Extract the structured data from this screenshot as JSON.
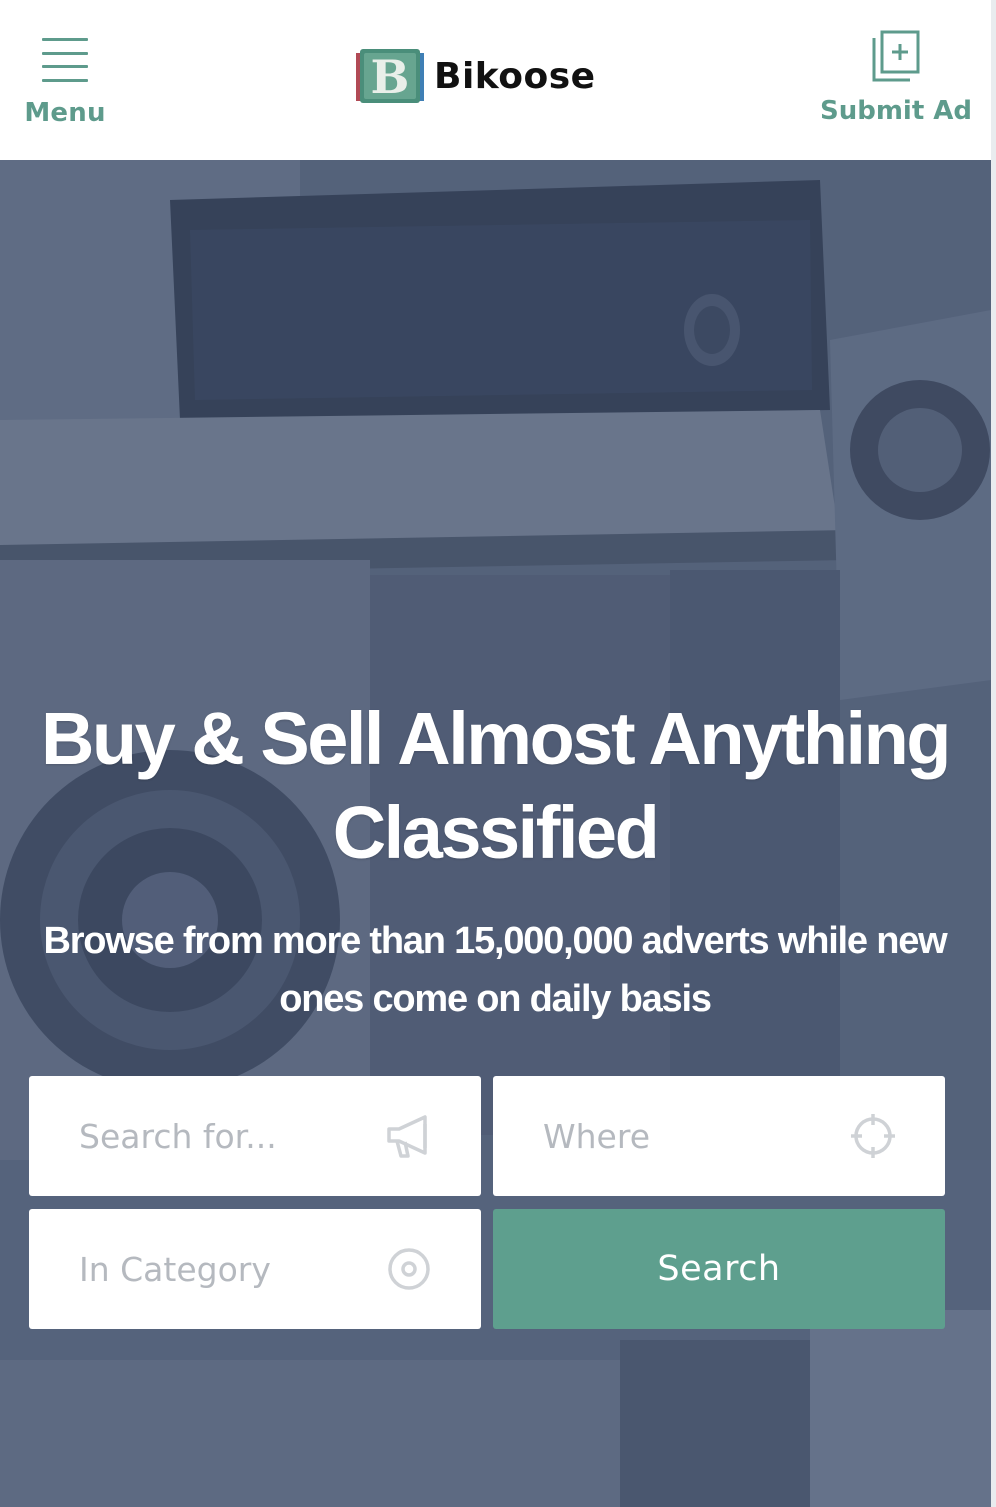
{
  "header": {
    "menu_label": "Menu",
    "logo_text": "Bikoose",
    "logo_mark_letter": "B",
    "submit_label": "Submit Ad",
    "icons": {
      "menu": "hamburger-icon",
      "submit": "add-document-icon"
    }
  },
  "hero": {
    "title": "Buy & Sell Almost Anything Classified",
    "subtitle": "Browse from more than 15,000,000 adverts while new ones come on daily basis"
  },
  "search": {
    "keyword_placeholder": "Search for...",
    "location_placeholder": "Where",
    "category_placeholder": "In Category",
    "button_label": "Search",
    "icons": {
      "keyword": "megaphone-icon",
      "location": "crosshair-icon",
      "category": "target-icon"
    }
  },
  "colors": {
    "accent": "#5e9f8e",
    "header_text": "#5e9b8c",
    "hero_overlay": "#5b6880",
    "field_background": "#ffffff",
    "placeholder": "#b5b9bf"
  }
}
